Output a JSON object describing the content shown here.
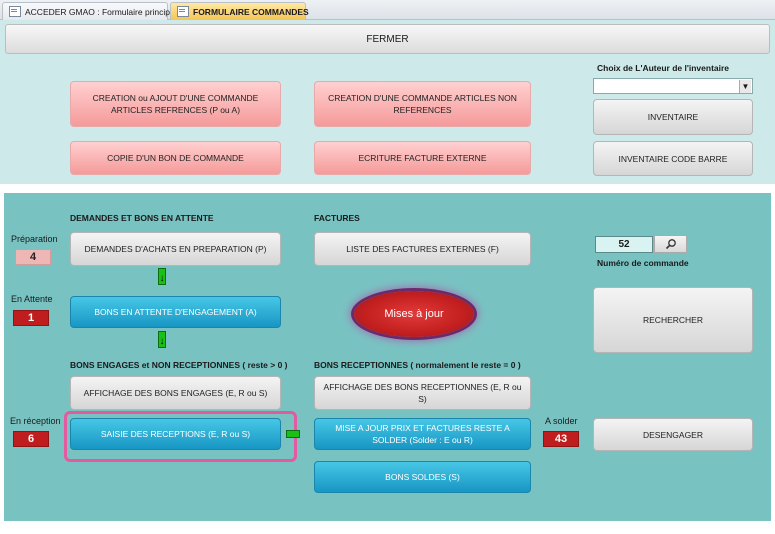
{
  "tabs": [
    {
      "label": "ACCEDER GMAO : Formulaire principal",
      "icon": "form-icon"
    },
    {
      "label": "FORMULAIRE COMMANDES",
      "icon": "form-icon"
    }
  ],
  "header": {
    "fermer_label": "FERMER"
  },
  "top": {
    "btn_creation_ref": "CREATION ou AJOUT D'UNE  COMMANDE ARTICLES REFRENCES (P ou A)",
    "btn_creation_nonref": "CREATION D'UNE COMMANDE ARTICLES NON REFERENCES",
    "btn_copie": "COPIE D'UN BON DE COMMANDE",
    "btn_ecriture": "ECRITURE FACTURE EXTERNE",
    "auteur_label": "Choix de L'Auteur de l'inventaire",
    "auteur_value": "",
    "btn_inventaire": "INVENTAIRE",
    "btn_inventaire_code": "INVENTAIRE CODE BARRE"
  },
  "main": {
    "demandes_title": "DEMANDES ET BONS EN ATTENTE",
    "factures_title": "FACTURES",
    "preparation_label": "Préparation",
    "preparation_count": "4",
    "btn_demandes": "DEMANDES D'ACHATS EN PREPARATION (P)",
    "btn_liste_factures": "LISTE DES FACTURES EXTERNES (F)",
    "attente_label": "En Attente",
    "attente_count": "1",
    "btn_bons_attente": "BONS EN ATTENTE D'ENGAGEMENT (A)",
    "btn_mises_a_jour": "Mises à jour",
    "engages_title": "BONS ENGAGES et NON RECEPTIONNES ( reste > 0 )",
    "receptionnes_title": "BONS RECEPTIONNES ( normalement le reste = 0 )",
    "btn_affichage_engages": "AFFICHAGE DES BONS ENGAGES (E, R ou S)",
    "btn_affichage_receptionnes": "AFFICHAGE DES BONS RECEPTIONNES (E, R ou S)",
    "reception_label": "En réception",
    "reception_count": "6",
    "btn_saisie": "SAISIE DES RECEPTIONS (E, R ou S)",
    "btn_mise_a_jour_prix": "MISE A JOUR PRIX ET FACTURES RESTE A SOLDER (Solder : E ou R)",
    "solder_label": "A solder",
    "solder_count": "43",
    "btn_bons_soldes": "BONS SOLDES (S)",
    "commande_number": "52",
    "commande_label": "Numéro de commande",
    "btn_rechercher": "RECHERCHER",
    "btn_desengager": "DESENGAGER"
  },
  "colors": {
    "accent_teal": "#1896c4",
    "pink": "#f59a9a",
    "counter_red": "#c01e1e",
    "highlight": "#e35aa0"
  }
}
